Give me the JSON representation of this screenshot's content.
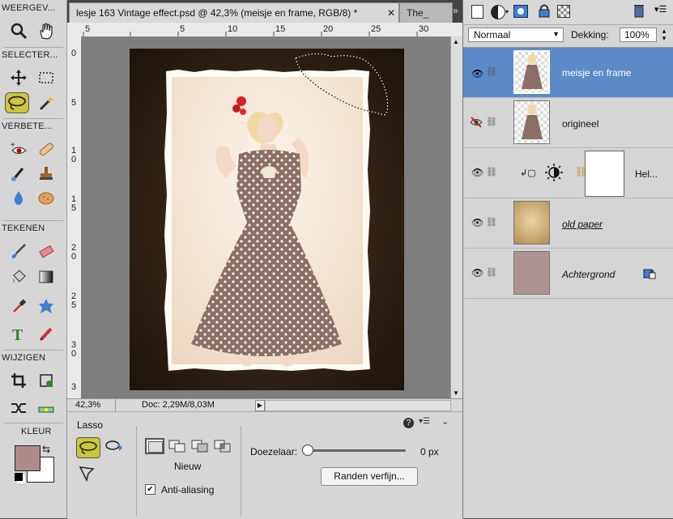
{
  "toolbox": {
    "section_view": "WEERGEV...",
    "section_select": "SELECTER...",
    "section_enhance": "VERBETE...",
    "section_draw": "TEKENEN",
    "section_modify": "WIJZIGEN",
    "section_color": "KLEUR",
    "foreground_color": "#b08a8a",
    "background_color": "#ffffff"
  },
  "tabs": [
    {
      "label": "lesje 163 Vintage effect.psd @ 42,3% (meisje en frame, RGB/8) *"
    },
    {
      "label": "The_"
    }
  ],
  "rulers": {
    "top": [
      "5",
      "10",
      "15",
      "20",
      "25",
      "30"
    ],
    "top_neg": "5",
    "left": [
      "0",
      "5",
      "1\n0",
      "1\n5",
      "2\n0",
      "2\n5",
      "3\n0",
      "3"
    ]
  },
  "status": {
    "zoom": "42,3%",
    "doc": "Doc: 2,29M/8,03M"
  },
  "options": {
    "tool_name": "Lasso",
    "mode_label": "Nieuw",
    "feather_label": "Doezelaar:",
    "feather_value": "0 px",
    "refine_button": "Randen verfijn...",
    "antialias_label": "Anti-aliasing",
    "antialias_checked": true
  },
  "layers_panel": {
    "blend_mode": "Normaal",
    "opacity_label": "Dekking:",
    "opacity_value": "100%",
    "layers": [
      {
        "name": "meisje en frame",
        "visible": true,
        "selected": true
      },
      {
        "name": "origineel",
        "visible": false,
        "selected": false
      },
      {
        "name": "Hel...",
        "visible": true,
        "selected": false
      },
      {
        "name": "old paper",
        "visible": true,
        "selected": false
      },
      {
        "name": "Achtergrond",
        "visible": true,
        "selected": false
      }
    ]
  },
  "colors": {
    "selected_layer": "#5b8ac8",
    "lasso_highlight": "#c9c63a",
    "background_layer": "#ae9393"
  }
}
